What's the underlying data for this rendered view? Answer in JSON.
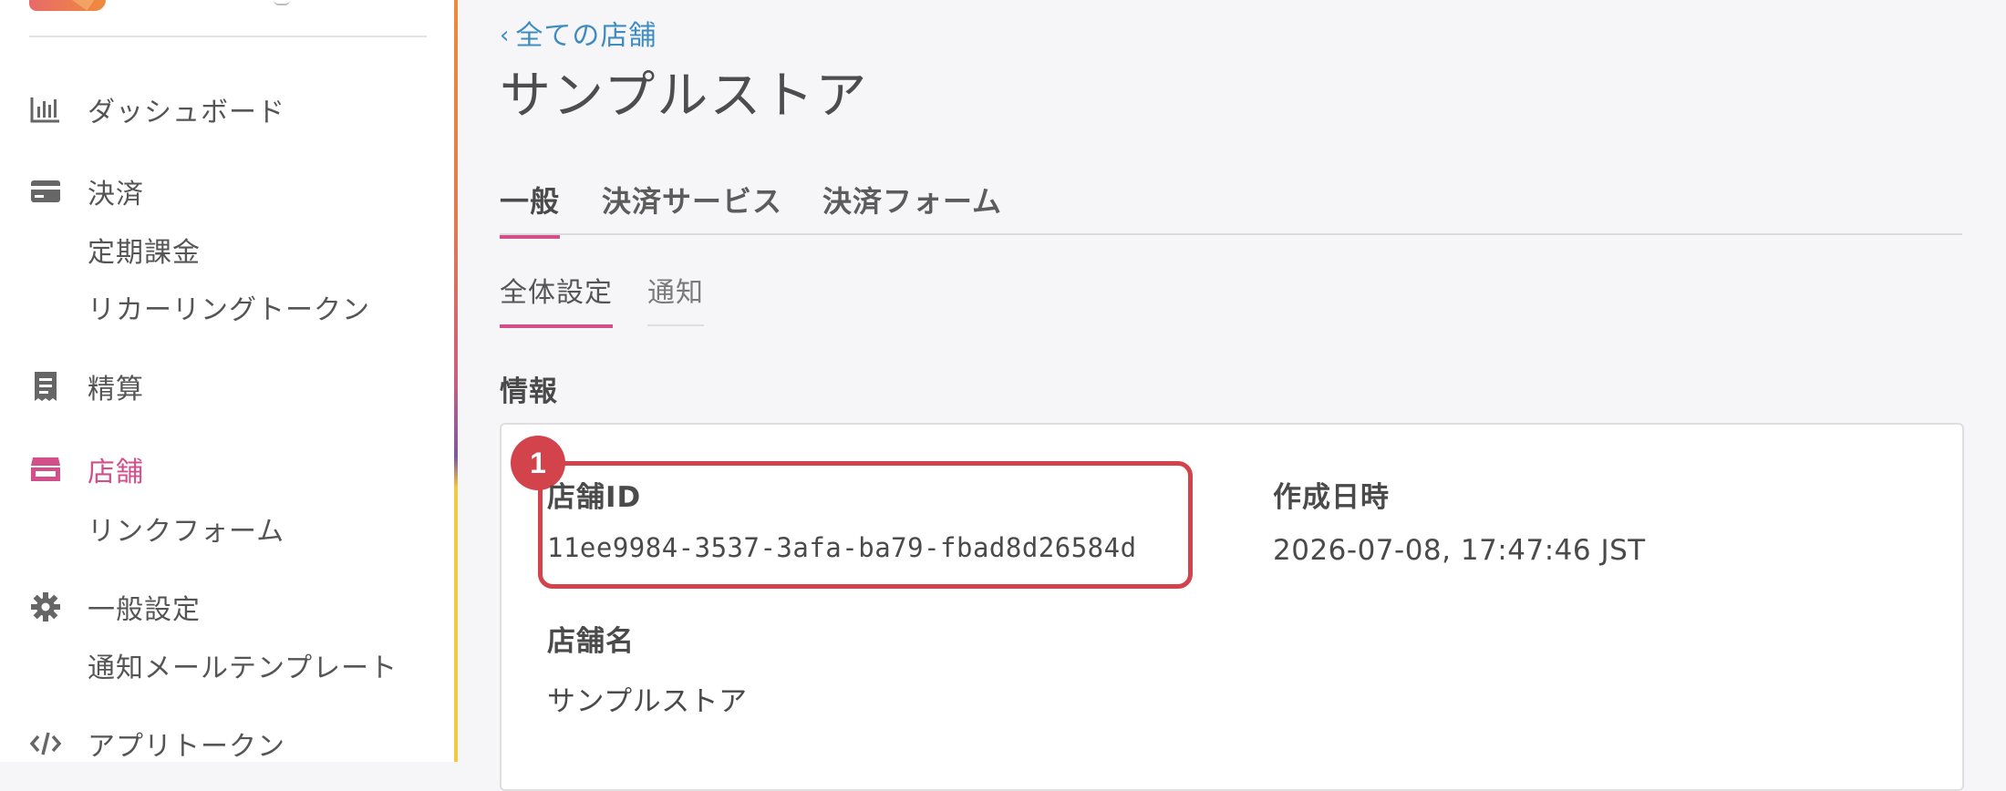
{
  "sidebar": {
    "items": [
      {
        "label": "ダッシュボード",
        "icon": "bar-chart-icon"
      },
      {
        "label": "決済",
        "icon": "credit-card-icon",
        "subitems": [
          "定期課金",
          "リカーリングトークン"
        ]
      },
      {
        "label": "精算",
        "icon": "receipt-icon"
      },
      {
        "label": "店舗",
        "icon": "store-icon",
        "active": true,
        "subitems": [
          "リンクフォーム"
        ]
      },
      {
        "label": "一般設定",
        "icon": "gear-icon",
        "subitems": [
          "通知メールテンプレート"
        ]
      },
      {
        "label": "アプリトークン",
        "icon": "code-icon"
      }
    ]
  },
  "breadcrumb": {
    "back_label": "全ての店舗"
  },
  "page": {
    "title": "サンプルストア"
  },
  "tabs": [
    {
      "label": "一般",
      "active": true
    },
    {
      "label": "決済サービス"
    },
    {
      "label": "決済フォーム"
    }
  ],
  "subtabs": [
    {
      "label": "全体設定",
      "active": true
    },
    {
      "label": "通知"
    }
  ],
  "info": {
    "section_title": "情報",
    "badge": "1",
    "store_id_label": "店舗ID",
    "store_id_value": "11ee9984-3537-3afa-ba79-fbad8d26584d",
    "created_label": "作成日時",
    "created_value": "2026-07-08, 17:47:46 JST",
    "store_name_label": "店舗名",
    "store_name_value": "サンプルストア"
  },
  "colors": {
    "accent": "#d24f8a",
    "link": "#3f8dc0",
    "highlight": "#d2434c"
  }
}
